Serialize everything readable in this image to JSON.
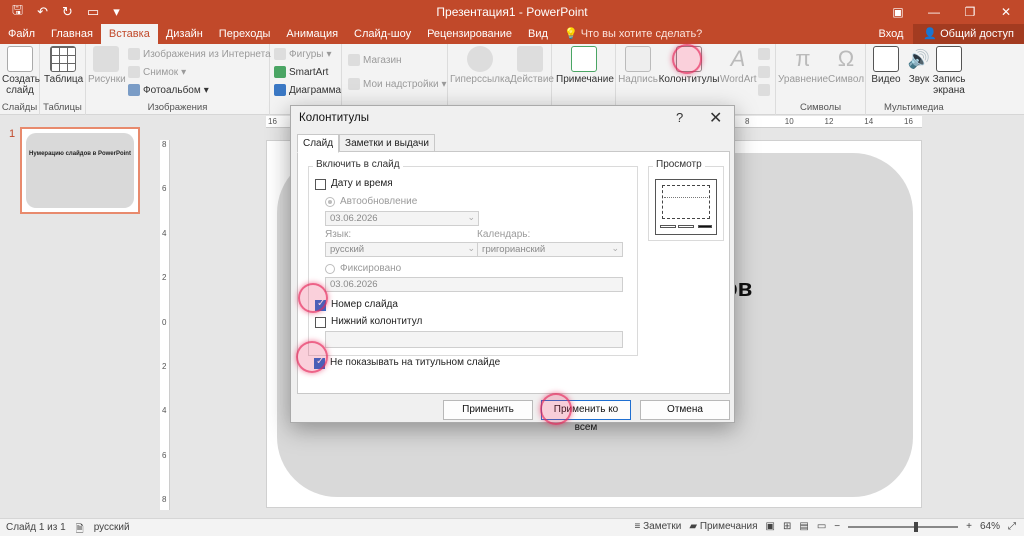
{
  "window": {
    "title": "Презентация1 - PowerPoint"
  },
  "tabs": [
    {
      "label": "Файл"
    },
    {
      "label": "Главная"
    },
    {
      "label": "Вставка"
    },
    {
      "label": "Дизайн"
    },
    {
      "label": "Переходы"
    },
    {
      "label": "Анимация"
    },
    {
      "label": "Слайд-шоу"
    },
    {
      "label": "Рецензирование"
    },
    {
      "label": "Вид"
    }
  ],
  "tellme": "Что вы хотите сделать?",
  "signin": "Вход",
  "share": "Общий доступ",
  "ribbon": {
    "slides": {
      "new_slide": "Создать слайд",
      "label": "Слайды"
    },
    "tables": {
      "table": "Таблица",
      "label": "Таблицы"
    },
    "images": {
      "pictures": "Рисунки",
      "online": "Изображения из Интернета",
      "screenshot": "Снимок",
      "album": "Фотоальбом",
      "label": "Изображения"
    },
    "illus": {
      "shapes": "Фигуры",
      "smartart": "SmartArt",
      "chart": "Диаграмма"
    },
    "addins": {
      "store": "Магазин",
      "my": "Мои надстройки"
    },
    "links": {
      "hyperlink": "Гиперссылка",
      "action": "Действие"
    },
    "comments": {
      "comment": "Примечание"
    },
    "text": {
      "textbox": "Надпись",
      "header_footer": "Колонтитулы",
      "wordart": "WordArt"
    },
    "symbols": {
      "equation": "Уравнение",
      "symbol": "Символ",
      "label": "Символы"
    },
    "media": {
      "video": "Видео",
      "audio": "Звук",
      "record": "Запись экрана",
      "label": "Мультимедиа"
    }
  },
  "thumbnail": {
    "number": "1",
    "title": "Нумерацию слайдов в PowerPoint"
  },
  "slide": {
    "title_fragment": "ов"
  },
  "dialog": {
    "title": "Колонтитулы",
    "help": "?",
    "tabs": [
      {
        "label": "Слайд"
      },
      {
        "label": "Заметки и выдачи"
      }
    ],
    "include_legend": "Включить в слайд",
    "date_time": {
      "label": "Дату и время",
      "checked": false
    },
    "auto_update": {
      "label": "Автообновление",
      "date_value": "03.06.2026"
    },
    "language_label": "Язык:",
    "language_value": "русский",
    "calendar_label": "Календарь:",
    "calendar_value": "григорианский",
    "fixed": {
      "label": "Фиксировано",
      "value": "03.06.2026"
    },
    "slide_number": {
      "label": "Номер слайда",
      "checked": true
    },
    "footer": {
      "label": "Нижний колонтитул",
      "checked": false,
      "value": ""
    },
    "dont_show_title": {
      "label": "Не показывать на титульном слайде",
      "checked": true
    },
    "preview_label": "Просмотр",
    "buttons": {
      "apply": "Применить",
      "apply_all": "Применить ко всем",
      "cancel": "Отмена"
    }
  },
  "status": {
    "slide_of": "Слайд 1 из 1",
    "language": "русский",
    "notes": "Заметки",
    "comments": "Примечания",
    "zoom": "64%"
  },
  "colors": {
    "accent": "#c1492a",
    "highlight": "#e6285a",
    "checkbox": "#1f6fd1"
  }
}
